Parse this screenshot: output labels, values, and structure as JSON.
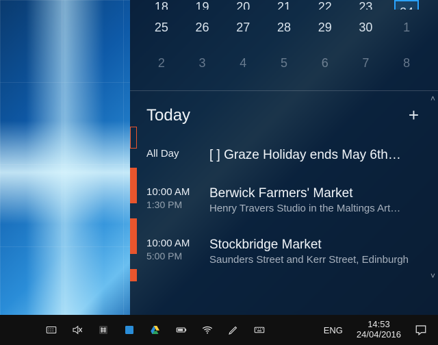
{
  "calendar": {
    "rows": [
      {
        "cells": [
          {
            "n": "18",
            "dim": false
          },
          {
            "n": "19",
            "dim": false
          },
          {
            "n": "20",
            "dim": false
          },
          {
            "n": "21",
            "dim": false
          },
          {
            "n": "22",
            "dim": false
          },
          {
            "n": "23",
            "dim": false
          },
          {
            "n": "24",
            "dim": false,
            "selected": true
          }
        ]
      },
      {
        "cells": [
          {
            "n": "25",
            "dim": false
          },
          {
            "n": "26",
            "dim": false
          },
          {
            "n": "27",
            "dim": false
          },
          {
            "n": "28",
            "dim": false
          },
          {
            "n": "29",
            "dim": false
          },
          {
            "n": "30",
            "dim": false
          },
          {
            "n": "1",
            "dim": true
          }
        ]
      },
      {
        "cells": [
          {
            "n": "2",
            "dim": true
          },
          {
            "n": "3",
            "dim": true
          },
          {
            "n": "4",
            "dim": true
          },
          {
            "n": "5",
            "dim": true
          },
          {
            "n": "6",
            "dim": true
          },
          {
            "n": "7",
            "dim": true
          },
          {
            "n": "8",
            "dim": true
          }
        ]
      }
    ]
  },
  "agenda": {
    "header": "Today",
    "add_icon": "+",
    "events": [
      {
        "color": "#e8552d",
        "bar_style": "hollow",
        "start": "All Day",
        "end": "",
        "title": "[  ] Graze Holiday ends May 6th…",
        "subtitle": ""
      },
      {
        "color": "#e8552d",
        "bar_style": "solid",
        "start": "10:00 AM",
        "end": "1:30 PM",
        "title": "Berwick Farmers' Market",
        "subtitle": "Henry Travers Studio in the Maltings Art…"
      },
      {
        "color": "#e8552d",
        "bar_style": "solid",
        "start": "10:00 AM",
        "end": "5:00 PM",
        "title": "Stockbridge Market",
        "subtitle": "Saunders Street and Kerr Street, Edinburgh"
      },
      {
        "color": "#e8552d",
        "bar_style": "solid",
        "start": "",
        "end": "",
        "title": "",
        "subtitle": ""
      }
    ]
  },
  "taskbar": {
    "left_icons": [
      {
        "name": "keyboard-grid-icon"
      },
      {
        "name": "volume-mute-icon"
      },
      {
        "name": "hash-icon"
      },
      {
        "name": "app-blue-icon"
      },
      {
        "name": "google-drive-icon"
      },
      {
        "name": "battery-icon"
      },
      {
        "name": "wifi-icon"
      },
      {
        "name": "pen-icon"
      },
      {
        "name": "onscreen-keyboard-icon"
      }
    ],
    "lang": "ENG",
    "clock": {
      "time": "14:53",
      "date": "24/04/2016"
    },
    "notif_icon": "action-center-icon"
  }
}
